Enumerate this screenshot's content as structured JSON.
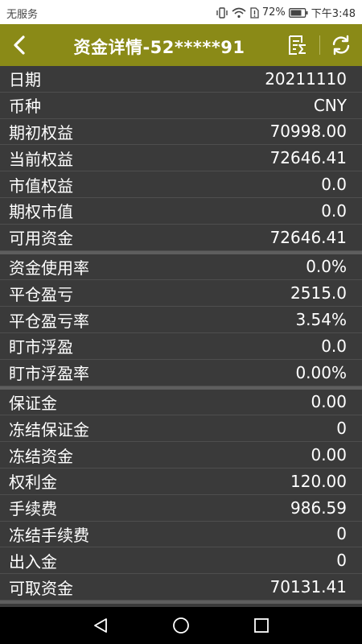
{
  "status_bar": {
    "carrier": "无服务",
    "battery_percent": "72%",
    "time": "下午3:48"
  },
  "header": {
    "title": "资金详情-52*****91",
    "back_icon": "chevron-left-icon",
    "summary_icon": "sum-list-icon",
    "refresh_icon": "refresh-icon"
  },
  "groups": [
    {
      "rows": [
        {
          "label": "日期",
          "value": "20211110"
        },
        {
          "label": "币种",
          "value": "CNY"
        },
        {
          "label": "期初权益",
          "value": "70998.00"
        },
        {
          "label": "当前权益",
          "value": "72646.41"
        },
        {
          "label": "市值权益",
          "value": "0.0"
        },
        {
          "label": "期权市值",
          "value": "0.0"
        },
        {
          "label": "可用资金",
          "value": "72646.41"
        }
      ]
    },
    {
      "rows": [
        {
          "label": "资金使用率",
          "value": "0.0%"
        },
        {
          "label": "平仓盈亏",
          "value": "2515.0"
        },
        {
          "label": "平仓盈亏率",
          "value": "3.54%"
        },
        {
          "label": "盯市浮盈",
          "value": "0.0"
        },
        {
          "label": "盯市浮盈率",
          "value": "0.00%"
        }
      ]
    },
    {
      "rows": [
        {
          "label": "保证金",
          "value": "0.00"
        },
        {
          "label": "冻结保证金",
          "value": "0"
        },
        {
          "label": "冻结资金",
          "value": "0.00"
        },
        {
          "label": "权利金",
          "value": "120.00"
        },
        {
          "label": "手续费",
          "value": "986.59"
        },
        {
          "label": "冻结手续费",
          "value": "0"
        },
        {
          "label": "出入金",
          "value": "0"
        },
        {
          "label": "可取资金",
          "value": "70131.41"
        }
      ]
    }
  ],
  "colors": {
    "header_bg": "#8a8a17",
    "list_bg": "#3a3a3a",
    "text": "#ffffff"
  }
}
